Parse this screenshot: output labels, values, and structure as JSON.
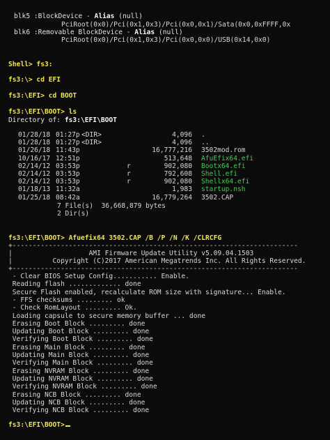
{
  "devices": [
    {
      "name": "blk5",
      "sep": " :",
      "type": "BlockDevice - ",
      "alias_label": "Alias",
      "alias_value": " (null)",
      "path": "PciRoot(0x0)/Pci(0x1,0x3)/Pci(0x0,0x1)/Sata(0x0,0xFFFF,0x"
    },
    {
      "name": "blk6",
      "sep": " :",
      "type": "Removable BlockDevice - ",
      "alias_label": "Alias",
      "alias_value": " (null)",
      "path": "PciRoot(0x0)/Pci(0x1,0x3)/Pci(0x0,0x0)/USB(0x14,0x0)"
    }
  ],
  "session": {
    "cmd1": {
      "prompt": "Shell>",
      "text": " fs3:"
    },
    "cmd2": {
      "prompt": "fs3:\\>",
      "text": " cd EFI"
    },
    "cmd3": {
      "prompt": "fs3:\\EFI>",
      "text": " cd BOOT"
    },
    "cmd4": {
      "prompt": "fs3:\\EFI\\BOOT>",
      "text": " ls"
    },
    "dir_label": "Directory of: ",
    "dir_path": "fs3:\\EFI\\BOOT",
    "files": [
      {
        "date": "01/28/18",
        "time": "01:27p",
        "attr": "<DIR>",
        "size": "4,096",
        "name": ".",
        "green": false
      },
      {
        "date": "01/28/18",
        "time": "01:27p",
        "attr": "<DIR>",
        "size": "4,096",
        "name": "..",
        "green": false
      },
      {
        "date": "01/26/18",
        "time": "11:43p",
        "attr": "",
        "size": "16,777,216",
        "name": "3502mod.rom",
        "green": false
      },
      {
        "date": "10/16/17",
        "time": "12:51p",
        "attr": "",
        "size": "513,648",
        "name": "AfuEfix64.efi",
        "green": true
      },
      {
        "date": "02/14/12",
        "time": "03:53p",
        "attr": "r",
        "size": "902,080",
        "name": "Bootx64.efi",
        "green": true
      },
      {
        "date": "02/14/12",
        "time": "03:53p",
        "attr": "r",
        "size": "792,608",
        "name": "Shell.efi",
        "green": true
      },
      {
        "date": "02/14/12",
        "time": "03:53p",
        "attr": "r",
        "size": "902,080",
        "name": "Shellx64.efi",
        "green": true
      },
      {
        "date": "01/18/13",
        "time": "11:32a",
        "attr": "",
        "size": "1,983",
        "name": "startup.nsh",
        "green": true
      },
      {
        "date": "01/25/18",
        "time": "08:42a",
        "attr": "",
        "size": "16,779,264",
        "name": "3502.CAP",
        "green": false
      }
    ],
    "summary_files": "7 File(s)  36,668,879 bytes",
    "summary_dirs": "2 Dir(s)",
    "cmd5": {
      "prompt": "fs3:\\EFI\\BOOT>",
      "text": " Afuefix64 3502.CAP /B /P /N /K /CLRCFG"
    }
  },
  "utility": {
    "border_top": "+-----------------------------------------------------------------------",
    "title": "|                   AMI Firmware Update Utility v5.09.04.1503",
    "copyright": "|          Copyright (C)2017 American Megatrends Inc. All Rights Reserved.",
    "border_bottom": "+-----------------------------------------------------------------------"
  },
  "log": [
    " - Clear BIOS Setup Config........... Enable.",
    " Reading flash ............. done",
    " Secure Flash enabled, recalculate ROM size with signature... Enable.",
    " - FFS checksums ......... ok",
    " - Check RomLayout ......... Ok.",
    " Loading capsule to secure memory buffer ... done",
    " Erasing Boot Block ......... done",
    " Updating Boot Block ......... done",
    " Verifying Boot Block ......... done",
    " Erasing Main Block ......... done",
    " Updating Main Block ......... done",
    " Verifying Main Block ......... done",
    " Erasing NVRAM Block ......... done",
    " Updating NVRAM Block ......... done",
    " Verifying NVRAM Block ......... done",
    " Erasing NCB Block ......... done",
    " Updating NCB Block ......... done",
    " Verifying NCB Block ......... done"
  ],
  "final_prompt": "fs3:\\EFI\\BOOT>",
  "colors": {
    "background": "#0b0b0c",
    "prompt_yellow": "#f2e64a",
    "file_green": "#3ed24a",
    "text": "#d8d8d8"
  }
}
